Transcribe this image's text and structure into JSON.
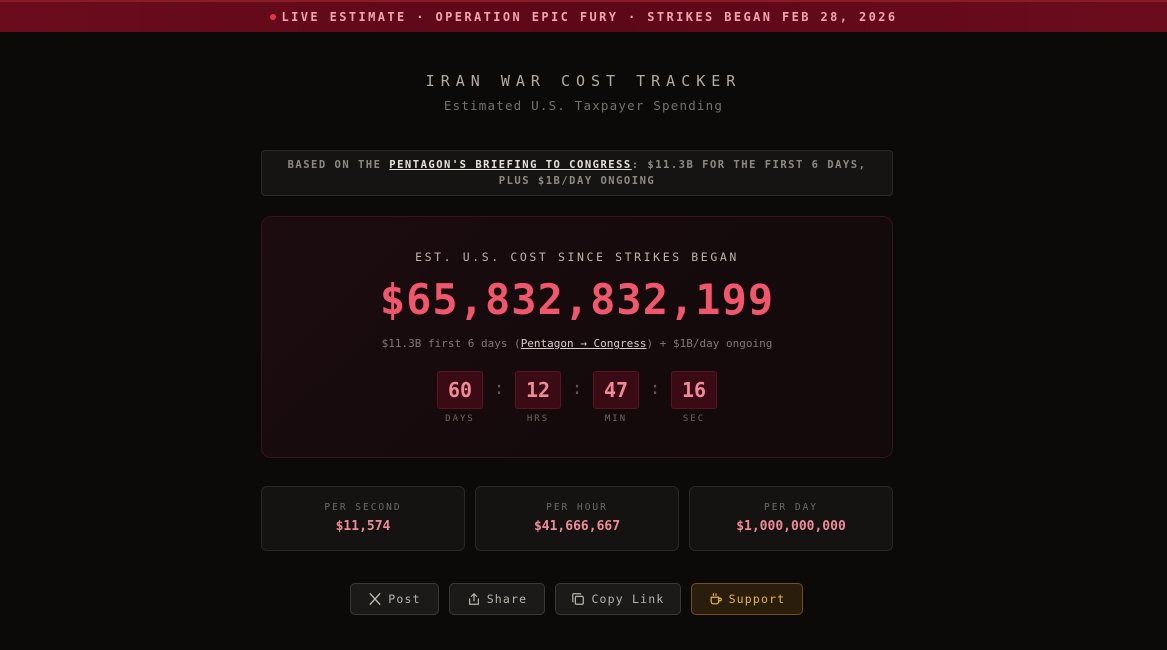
{
  "banner": {
    "text": "LIVE ESTIMATE · OPERATION EPIC FURY · STRIKES BEGAN FEB 28, 2026"
  },
  "header": {
    "title": "IRAN WAR COST TRACKER",
    "subtitle": "Estimated U.S. Taxpayer Spending"
  },
  "source": {
    "prefix": "BASED ON THE ",
    "link_text": "PENTAGON'S BRIEFING TO CONGRESS",
    "suffix": ": $11.3B FOR THE FIRST 6 DAYS, PLUS $1B/DAY ONGOING"
  },
  "main": {
    "label": "EST. U.S. COST SINCE STRIKES BEGAN",
    "amount": "$65,832,832,199",
    "note_prefix": "$11.3B first 6 days (",
    "note_link": "Pentagon → Congress",
    "note_suffix": ") + $1B/day ongoing"
  },
  "timer": {
    "separator": ":",
    "units": [
      {
        "value": "60",
        "label": "DAYS"
      },
      {
        "value": "12",
        "label": "HRS"
      },
      {
        "value": "47",
        "label": "MIN"
      },
      {
        "value": "16",
        "label": "SEC"
      }
    ]
  },
  "stats": [
    {
      "label": "PER SECOND",
      "value": "$11,574"
    },
    {
      "label": "PER HOUR",
      "value": "$41,666,667"
    },
    {
      "label": "PER DAY",
      "value": "$1,000,000,000"
    }
  ],
  "buttons": {
    "post": {
      "label": "Post",
      "icon": "x-logo-icon"
    },
    "share": {
      "label": "Share",
      "icon": "share-icon"
    },
    "copy": {
      "label": "Copy Link",
      "icon": "copy-icon"
    },
    "support": {
      "label": "Support",
      "icon": "coffee-icon"
    }
  },
  "colors": {
    "accent": "#f0566c",
    "banner": "#5c0818",
    "support": "#e7b64a"
  }
}
